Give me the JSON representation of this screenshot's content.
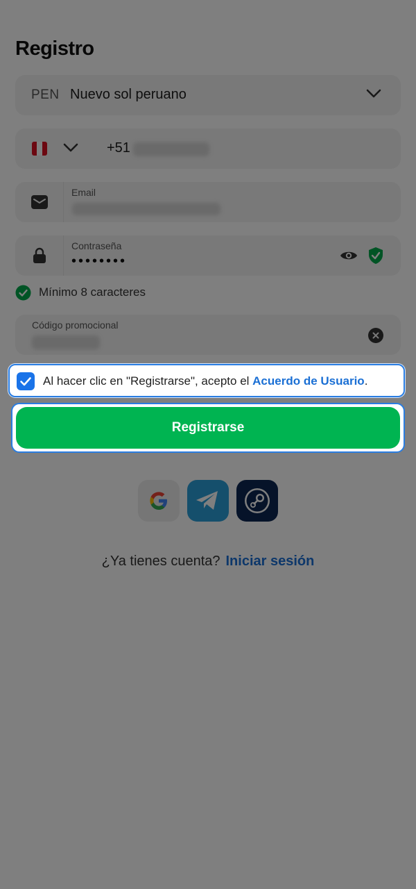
{
  "title": "Registro",
  "currency": {
    "code": "PEN",
    "name": "Nuevo sol peruano"
  },
  "phone": {
    "prefix": "+51"
  },
  "email": {
    "label": "Email"
  },
  "password": {
    "label": "Contraseña",
    "masked_value": "••••••••"
  },
  "password_hint": "Mínimo 8 caracteres",
  "promo": {
    "label": "Código promocional"
  },
  "terms": {
    "text_before": "Al hacer clic en \"Registrarse\", acepto el ",
    "link": "Acuerdo de Usuario",
    "text_after": "."
  },
  "register_button": "Registrarse",
  "social": [
    "google-icon",
    "telegram-icon",
    "steam-icon"
  ],
  "login_prompt": {
    "question": "¿Ya tienes cuenta?",
    "link": "Iniciar sesión"
  },
  "colors": {
    "accent": "#1a73e8",
    "primary_green": "#00b451",
    "link": "#1a6fd4",
    "overlay": "rgba(0,0,0,0.5)"
  }
}
